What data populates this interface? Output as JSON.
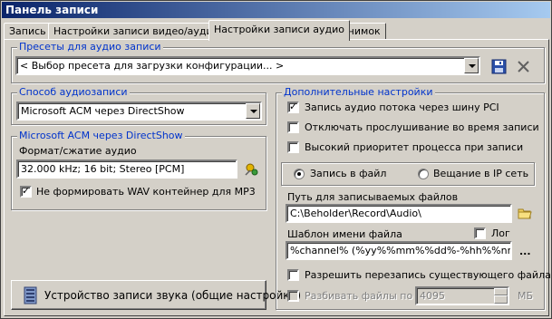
{
  "window": {
    "title": "Панель записи"
  },
  "tabs": [
    {
      "label": "Запись"
    },
    {
      "label": "Настройки записи видео/аудио"
    },
    {
      "label": "Настройки записи аудио"
    },
    {
      "label": "Снимок"
    }
  ],
  "presets": {
    "title": "Пресеты для аудио записи",
    "value": "< Выбор пресета для загрузки конфигурации... >"
  },
  "audio_method": {
    "title": "Способ аудиозаписи",
    "value": "Microsoft ACM через DirectShow"
  },
  "acm": {
    "title": "Microsoft ACM через DirectShow",
    "format_label": "Формат/сжатие аудио",
    "format_value": "32.000 kHz; 16 bit; Stereo [PCM]",
    "no_wav_label": "Не формировать WAV контейнер для MP3"
  },
  "device_button": {
    "label": "Устройство записи звука (общие настройки)"
  },
  "extra": {
    "title": "Дополнительные настройки",
    "pci_label": "Запись аудио потока через шину PCI",
    "disable_listen_label": "Отключать прослушивание во время записи",
    "high_priority_label": "Высокий приоритет процесса при записи",
    "radio_file_label": "Запись в файл",
    "radio_ip_label": "Вещание в IP сеть",
    "path_label": "Путь для записываемых файлов",
    "path_value": "C:\\Beholder\\Record\\Audio\\",
    "template_label": "Шаблон имени файла",
    "log_label": "Лог",
    "template_value": "%channel% (%yy%%mm%%dd%-%hh%%nn%",
    "ellipsis": "...",
    "overwrite_label": "Разрешить перезапись существующего файла",
    "split_label": "Разбивать файлы по",
    "split_value": "4095",
    "split_unit": "МБ"
  },
  "colors": {
    "group_title": "#0033cc",
    "title_bar_start": "#0a246a",
    "title_bar_end": "#a6caf0"
  },
  "icons": [
    "save-icon",
    "close-icon",
    "dropper-settings-icon",
    "folder-icon",
    "device-icon"
  ]
}
